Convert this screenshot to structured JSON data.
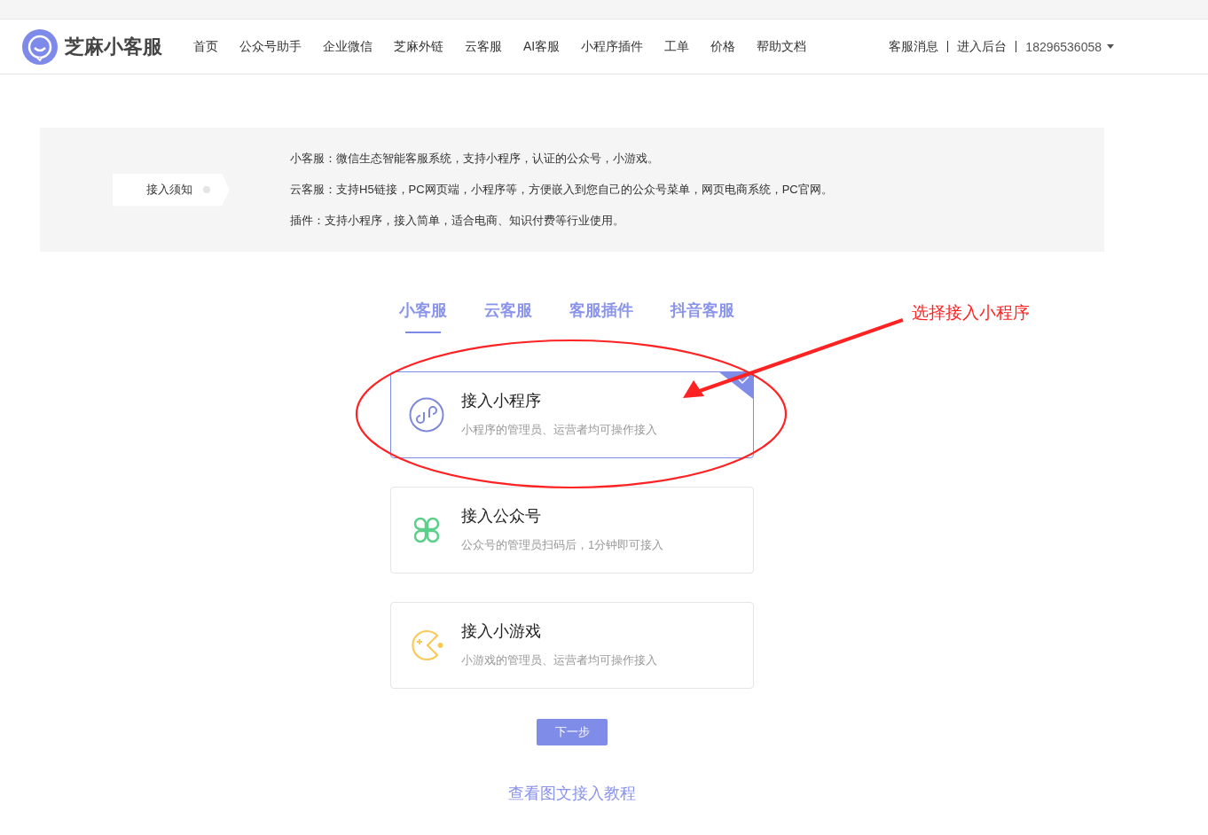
{
  "header": {
    "brand": "芝麻小客服",
    "nav": [
      {
        "label": "首页"
      },
      {
        "label": "公众号助手"
      },
      {
        "label": "企业微信"
      },
      {
        "label": "芝麻外链"
      },
      {
        "label": "云客服"
      },
      {
        "label": "AI客服"
      },
      {
        "label": "小程序插件"
      },
      {
        "label": "工单"
      },
      {
        "label": "价格"
      },
      {
        "label": "帮助文档"
      }
    ],
    "account_links": [
      "客服消息",
      "进入后台"
    ],
    "user": "18296536058"
  },
  "notice": {
    "label": "接入须知",
    "lines": [
      "小客服：微信生态智能客服系统，支持小程序，认证的公众号，小游戏。",
      "云客服：支持H5链接，PC网页端，小程序等，方便嵌入到您自己的公众号菜单，网页电商系统，PC官网。",
      "插件：支持小程序，接入简单，适合电商、知识付费等行业使用。"
    ]
  },
  "tabs": [
    {
      "label": "小客服",
      "selected": true
    },
    {
      "label": "云客服",
      "selected": false
    },
    {
      "label": "客服插件",
      "selected": false
    },
    {
      "label": "抖音客服",
      "selected": false
    }
  ],
  "options": [
    {
      "kind": "miniprogram",
      "title": "接入小程序",
      "description": "小程序的管理员、运营者均可操作接入",
      "selected": true
    },
    {
      "kind": "official",
      "title": "接入公众号",
      "description": "公众号的管理员扫码后，1分钟即可接入",
      "selected": false
    },
    {
      "kind": "game",
      "title": "接入小游戏",
      "description": "小游戏的管理员、运营者均可操作接入",
      "selected": false
    }
  ],
  "next_button": "下一步",
  "tutorial_link": "查看图文接入教程",
  "annotation": {
    "text": "选择接入小程序"
  }
}
